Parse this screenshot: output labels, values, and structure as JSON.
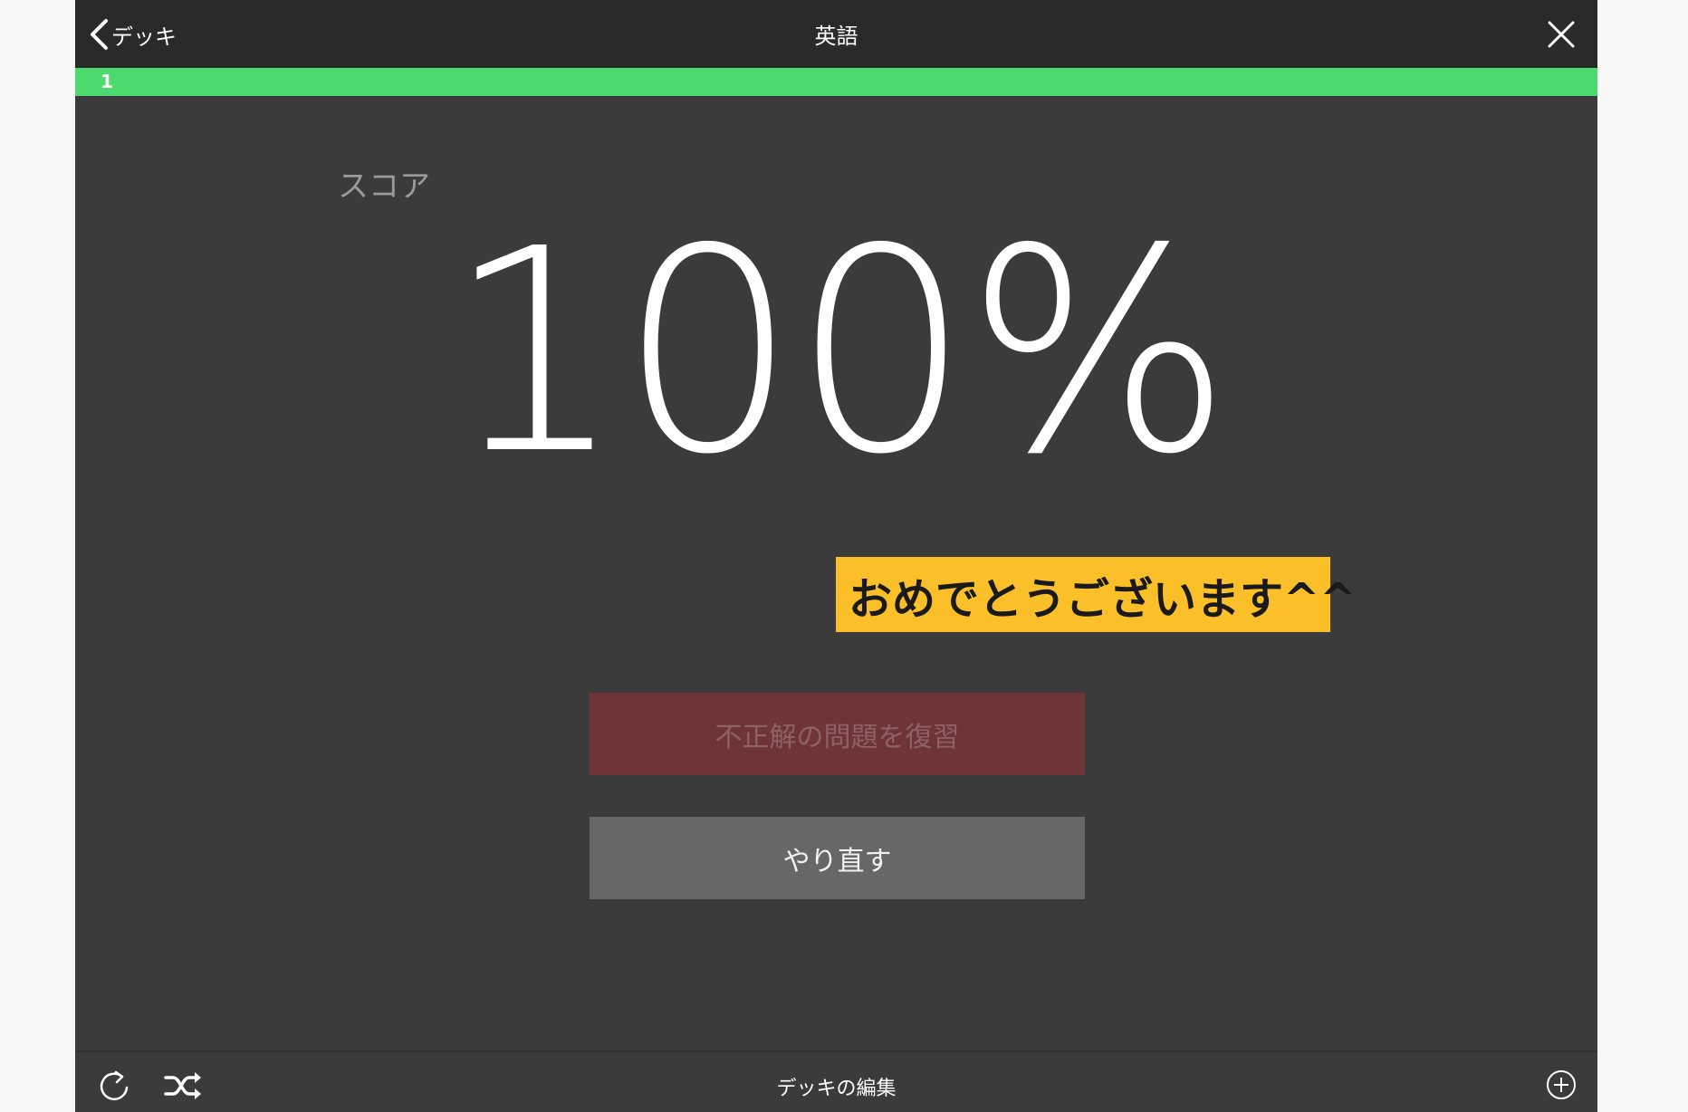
{
  "header": {
    "back_label": "デッキ",
    "title": "英語"
  },
  "progress": {
    "label": "1",
    "fraction": 1.0,
    "color": "#4cd96e"
  },
  "score": {
    "label": "スコア",
    "value": "100%"
  },
  "congrats_banner": "おめでとうございます^^",
  "buttons": {
    "review_incorrect": "不正解の問題を復習",
    "retry": "やり直す"
  },
  "footer": {
    "edit_deck": "デッキの編集"
  },
  "icons": {
    "back": "chevron-left-icon",
    "close": "close-icon",
    "reload": "reload-icon",
    "shuffle": "shuffle-icon",
    "add": "add-circle-icon"
  },
  "colors": {
    "background": "#3b3b3b",
    "topbar": "#2a2a2a",
    "banner": "#fbbf2a",
    "review_button": "#6f3436",
    "retry_button": "#676767"
  }
}
